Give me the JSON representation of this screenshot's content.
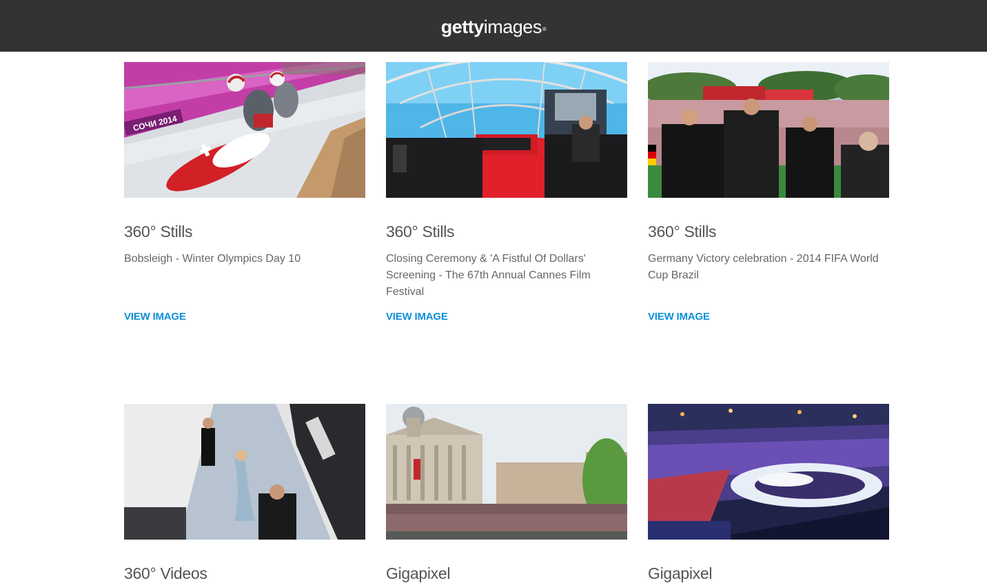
{
  "header": {
    "logo_bold": "getty",
    "logo_light": "images",
    "logo_mark": "®"
  },
  "cards": [
    {
      "title": "360° Stills",
      "description": "Bobsleigh - Winter Olympics Day 10",
      "link": "VIEW IMAGE"
    },
    {
      "title": "360° Stills",
      "description": "Closing Ceremony & 'A Fistful Of Dollars' Screening - The 67th Annual Cannes Film Festival",
      "link": "VIEW IMAGE"
    },
    {
      "title": "360° Stills",
      "description": "Germany Victory celebration - 2014 FIFA World Cup Brazil",
      "link": "VIEW IMAGE"
    },
    {
      "title": "360° Videos",
      "description": "",
      "link": ""
    },
    {
      "title": "Gigapixel",
      "description": "",
      "link": ""
    },
    {
      "title": "Gigapixel",
      "description": "",
      "link": ""
    }
  ],
  "image_text": {
    "sochi_banner": "СОЧИ 2014"
  },
  "colors": {
    "header_bg": "#333333",
    "link": "#0c8fd9",
    "title": "#555555",
    "description": "#666666"
  }
}
